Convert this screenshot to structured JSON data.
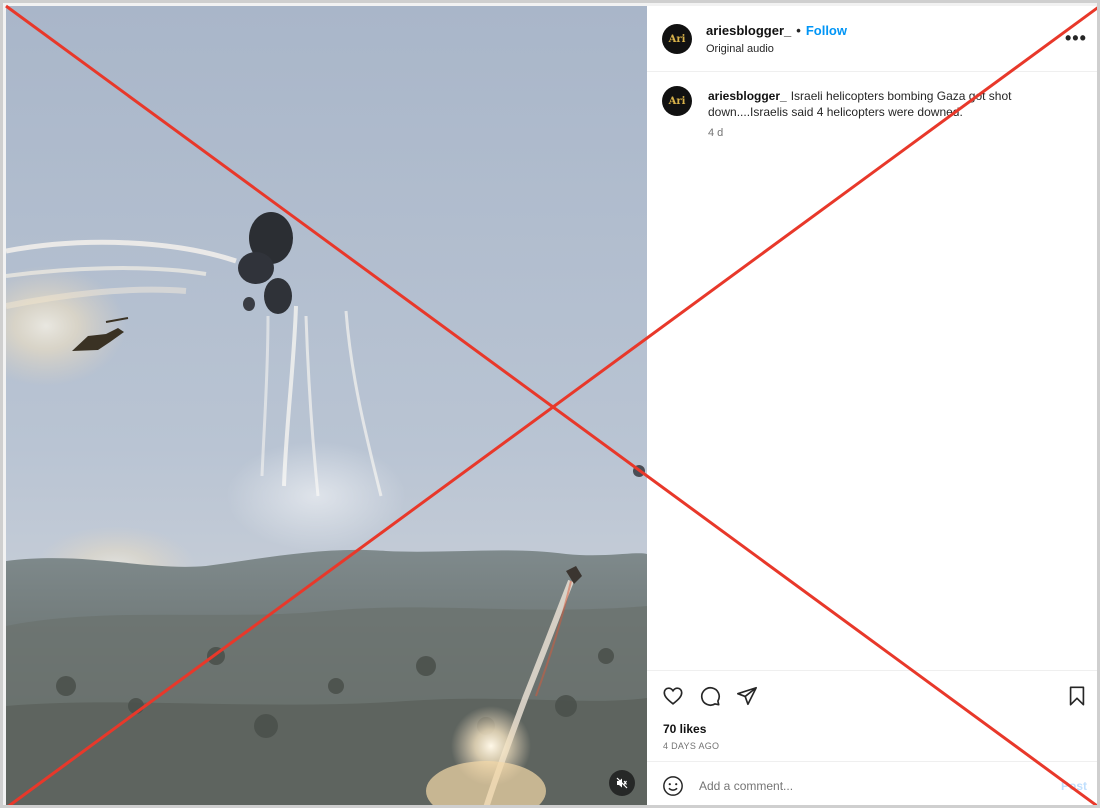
{
  "post": {
    "username": "ariesblogger_",
    "separator": "•",
    "follow_label": "Follow",
    "audio_label": "Original audio",
    "more_label": "•••",
    "avatar_text": "Ari"
  },
  "caption": {
    "username": "ariesblogger_",
    "text": "Israeli helicopters bombing Gaza got shot down....Israelis said 4 helicopters were downed.",
    "time": "4 d"
  },
  "actions": {
    "like_icon": "heart-icon",
    "comment_icon": "comment-icon",
    "share_icon": "share-icon",
    "save_icon": "bookmark-icon"
  },
  "stats": {
    "likes": "70 likes",
    "date": "4 DAYS AGO"
  },
  "comment": {
    "emoji_icon": "emoji-icon",
    "placeholder": "Add a comment...",
    "post_label": "Post"
  },
  "media": {
    "mute_icon": "speaker-muted-icon"
  },
  "overlay": {
    "cross_color": "#e8382a"
  }
}
